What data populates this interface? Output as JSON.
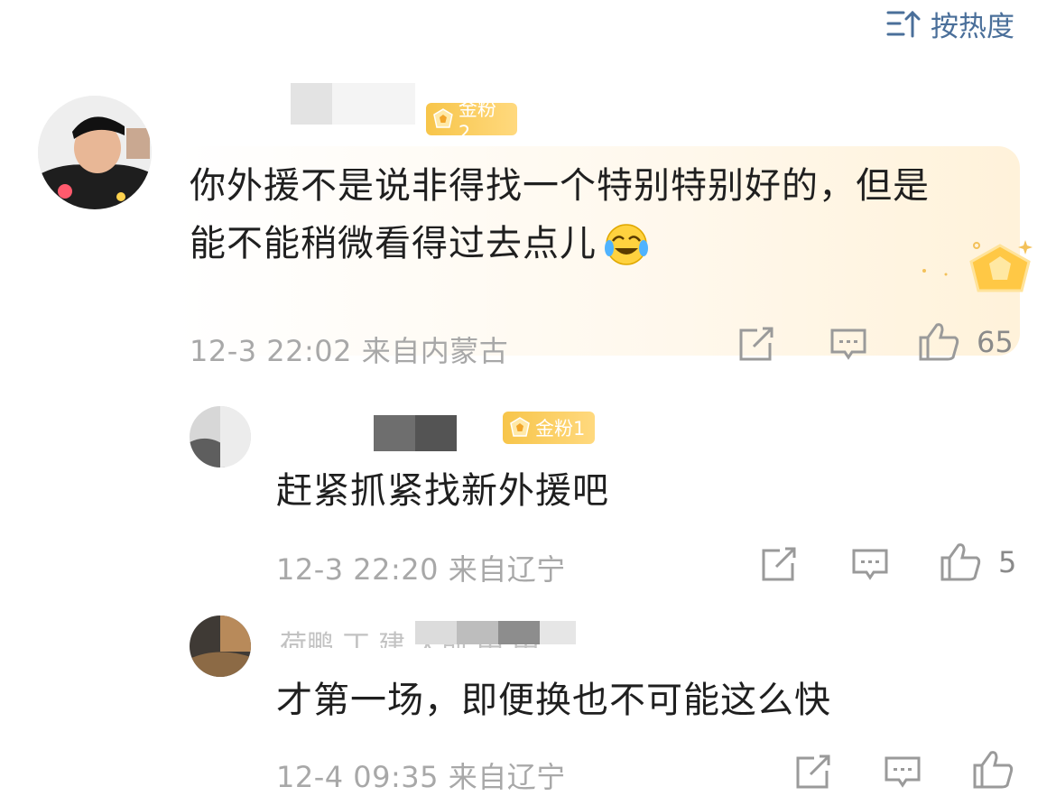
{
  "header": {
    "sort_label": "按热度",
    "sort_icon": "sort-descending-icon"
  },
  "comments": [
    {
      "badge": "金粉2",
      "text_line1": "你外援不是说非得找一个特别特别好的，但是",
      "text_line2": "能不能稍微看得过去点儿",
      "emoji": "laughing-crying-emoji",
      "meta": "12-3 22:02 来自内蒙古",
      "likes": "65"
    },
    {
      "badge": "金粉1",
      "text": "赶紧抓紧找新外援吧",
      "meta": "12-3 22:20 来自辽宁",
      "likes": "5"
    },
    {
      "reply_preview": "荷鹏 丁 建 天前 中 中",
      "text": "才第一场，即便换也不可能这么快",
      "meta": "12-4 09:35 来自辽宁",
      "likes": ""
    }
  ],
  "colors": {
    "accent": "#4a6f9a",
    "badge": "#f7c54a",
    "meta": "#a8a8a8"
  },
  "icons": [
    "share-icon",
    "comment-icon",
    "like-icon"
  ]
}
